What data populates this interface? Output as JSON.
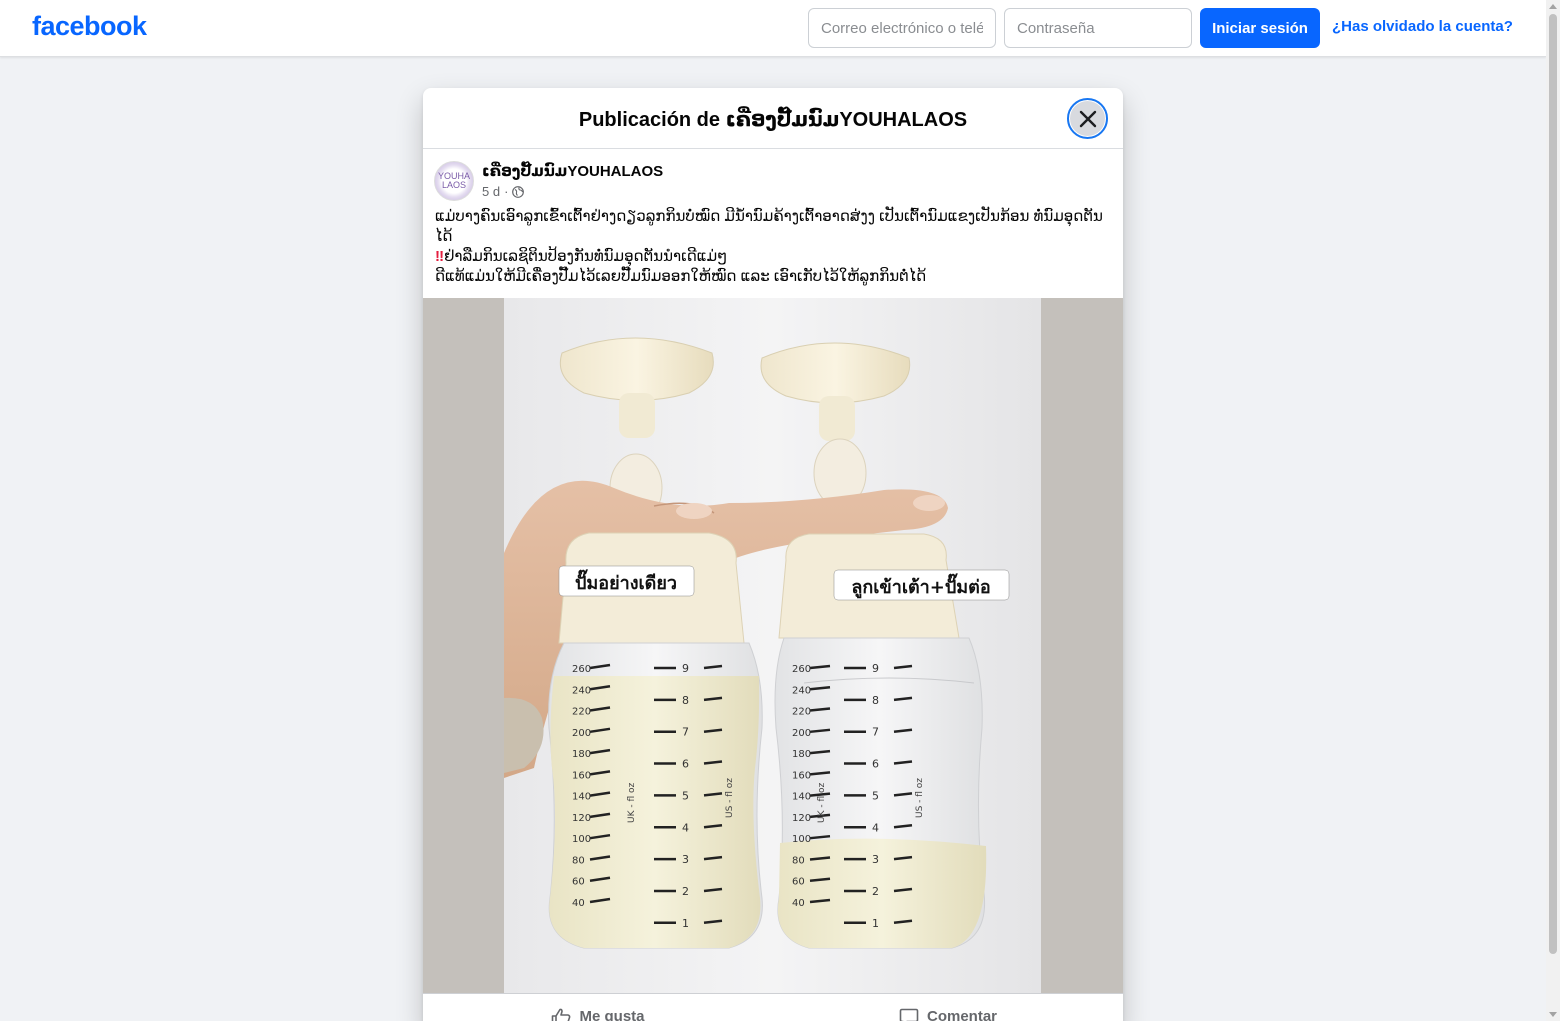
{
  "topbar": {
    "logo": "facebook",
    "email_placeholder": "Correo electrónico o teléfono",
    "password_placeholder": "Contraseña",
    "login_label": "Iniciar sesión",
    "forgot_label": "¿Has olvidado la cuenta?"
  },
  "modal": {
    "title": "Publicación de ເຄື່ອງປັ໊ມນົມYOUHALAOS",
    "post": {
      "avatar_text": "YOUHA LAOS",
      "page_name": "ເຄື່ອງປັ໊ມນົມYOUHALAOS",
      "time": "5 d",
      "privacy_icon": "globe-icon",
      "lines": [
        "ແມ່ບາງຄົນເອົາລູກເຂົ້າເຕົ້າຢ່າງດຽວລູກກິນບໍ່ໝົດ ມີນ້ຳນົມຄ້າງເຕົ້າອາດສ່ງງ ເປັນເຕົ້ານົມແຂງເປັນກ້ອນ ທໍ່ນົມອຸດຕັນໄດ້",
        "ຢ່າລືມກິນເລຊິຕິນປ້ອງກັນທໍ່ນົມອຸດຕັນນຳເດີແມ່ໆ",
        "ດີແທ້ແມ່ນໃຫ້ມີເຄື່ອງປັ໊ມໄວ້ເລຍປັ໊ມນົມອອກໃຫ້ໝົດ ແລະ ເອົາເກັບໄວ້ໃຫ້ລູກກິນຕໍ່ໄດ້"
      ],
      "photo": {
        "label_left": "ปั๊มอย่างเดียว",
        "label_right": "ลูกเข้าเต้า+ปั๊มต่อ",
        "ml_marks": [
          "260",
          "240",
          "220",
          "200",
          "180",
          "160",
          "140",
          "120",
          "100",
          "80",
          "60",
          "40"
        ],
        "oz_marks": [
          "9",
          "8",
          "7",
          "6",
          "5",
          "4",
          "3",
          "2",
          "1"
        ],
        "uk_label": "UK - fl oz",
        "us_label": "US - fl oz",
        "left_fill_level": 0.82,
        "right_fill_level": 0.35
      }
    },
    "actions": {
      "like_label": "Me gusta",
      "comment_label": "Comentar"
    }
  },
  "colors": {
    "brand": "#0866ff",
    "page_bg": "#f0f2f5",
    "milk": "#f0ecd6"
  }
}
